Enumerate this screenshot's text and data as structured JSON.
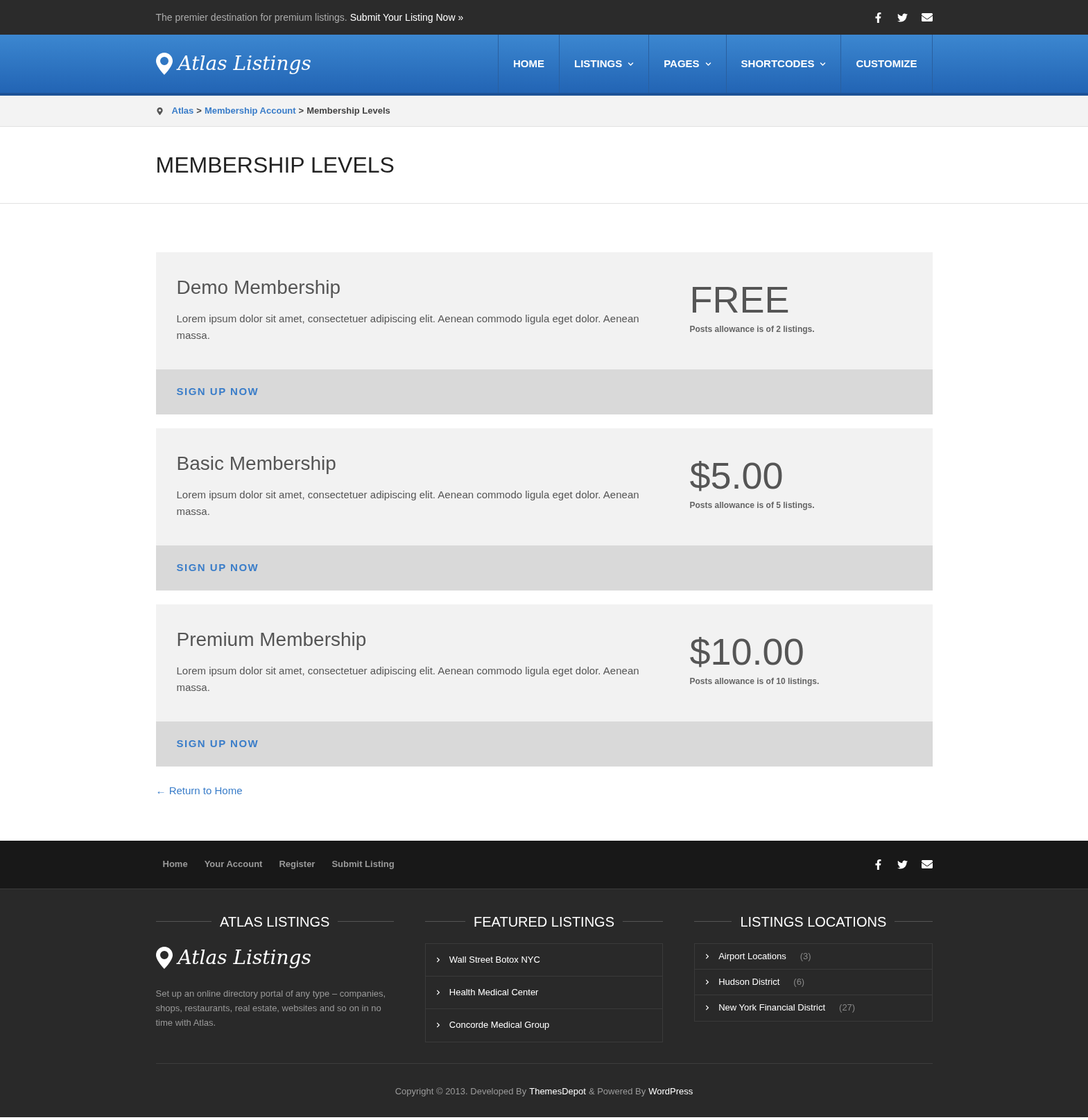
{
  "top_bar": {
    "tagline": "The premier destination for premium listings.",
    "link": "Submit Your Listing Now »"
  },
  "logo": "Atlas Listings",
  "nav": [
    {
      "label": "HOME",
      "dropdown": false
    },
    {
      "label": "LISTINGS",
      "dropdown": true
    },
    {
      "label": "PAGES",
      "dropdown": true
    },
    {
      "label": "SHORTCODES",
      "dropdown": true
    },
    {
      "label": "CUSTOMIZE",
      "dropdown": false
    }
  ],
  "breadcrumb": {
    "links": [
      "Atlas",
      "Membership Account"
    ],
    "current": "Membership Levels",
    "separator": ">"
  },
  "page_title": "MEMBERSHIP LEVELS",
  "levels": [
    {
      "name": "Demo Membership",
      "description": "Lorem ipsum dolor sit amet, consectetuer adipiscing elit. Aenean commodo ligula eget dolor. Aenean massa.",
      "price": "FREE",
      "allowance": "Posts allowance is of **2** listings.",
      "button": "SIGN UP NOW"
    },
    {
      "name": "Basic Membership",
      "description": "Lorem ipsum dolor sit amet, consectetuer adipiscing elit. Aenean commodo ligula eget dolor. Aenean massa.",
      "price": "$5.00",
      "allowance": "Posts allowance is of **5** listings.",
      "button": "SIGN UP NOW"
    },
    {
      "name": "Premium Membership",
      "description": "Lorem ipsum dolor sit amet, consectetuer adipiscing elit. Aenean commodo ligula eget dolor. Aenean massa.",
      "price": "$10.00",
      "allowance": "Posts allowance is of **10** listings.",
      "button": "SIGN UP NOW"
    }
  ],
  "return_link": "← Return to Home",
  "footer_nav": [
    "Home",
    "Your Account",
    "Register",
    "Submit Listing"
  ],
  "footer_widgets": {
    "about": {
      "title": "ATLAS LISTINGS",
      "logo": "Atlas Listings",
      "text": "Set up an online directory portal of any type – companies, shops, restaurants, real estate, websites and so on in no time with Atlas."
    },
    "featured": {
      "title": "FEATURED LISTINGS",
      "items": [
        "Wall Street Botox NYC",
        "Health Medical Center",
        "Concorde Medical Group"
      ]
    },
    "locations": {
      "title": "LISTINGS LOCATIONS",
      "items": [
        {
          "name": "Airport Locations",
          "count": "(3)"
        },
        {
          "name": "Hudson District",
          "count": "(6)"
        },
        {
          "name": "New York Financial District",
          "count": "(27)"
        }
      ]
    }
  },
  "copyright": {
    "text": "Copyright © 2013. Developed By",
    "developer": "ThemesDepot",
    "middle": "& Powered By",
    "platform": "WordPress"
  }
}
